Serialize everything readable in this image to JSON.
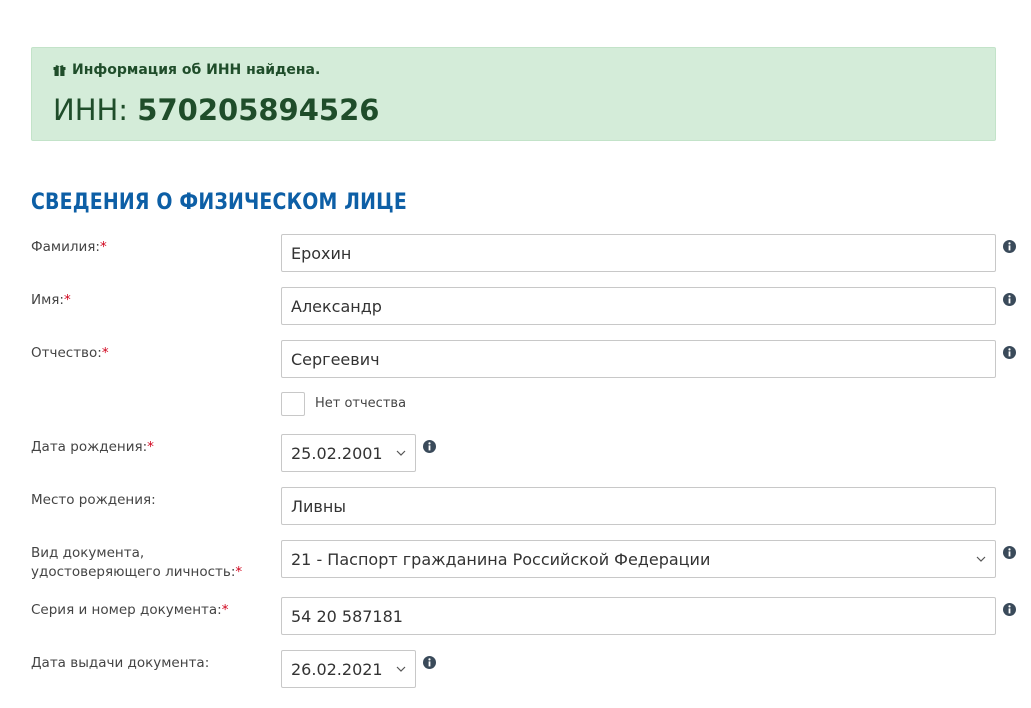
{
  "alert": {
    "message": "Информация об ИНН найдена.",
    "inn_prefix": "ИНН: ",
    "inn_value": "570205894526",
    "icon": "gift-icon"
  },
  "section_title": "СВЕДЕНИЯ О ФИЗИЧЕСКОМ ЛИЦЕ",
  "form": {
    "last_name": {
      "label": "Фамилия:",
      "required": "*",
      "value": "Ерохин"
    },
    "first_name": {
      "label": "Имя:",
      "required": "*",
      "value": "Александр"
    },
    "patronymic": {
      "label": "Отчество:",
      "required": "*",
      "value": "Сергеевич"
    },
    "no_patronymic": {
      "label": "Нет отчества",
      "checked": false
    },
    "birth_date": {
      "label": "Дата рождения:",
      "required": "*",
      "value": "25.02.2001"
    },
    "birth_place": {
      "label": "Место рождения:",
      "value": "Ливны"
    },
    "doc_type": {
      "label_line1": "Вид документа,",
      "label_line2": "удостоверяющего личность:",
      "required": "*",
      "value": "21 - Паспорт гражданина Российской Федерации"
    },
    "doc_number": {
      "label": "Серия и номер документа:",
      "required": "*",
      "value": "54 20 587181"
    },
    "doc_issue_date": {
      "label": "Дата выдачи документа:",
      "value": "26.02.2021"
    }
  },
  "colors": {
    "alert_bg": "#d4ecd9",
    "alert_text": "#1f4d2a",
    "section_title": "#0d5fa6",
    "required": "#d0021b",
    "info_icon": "#3a4a5a"
  }
}
